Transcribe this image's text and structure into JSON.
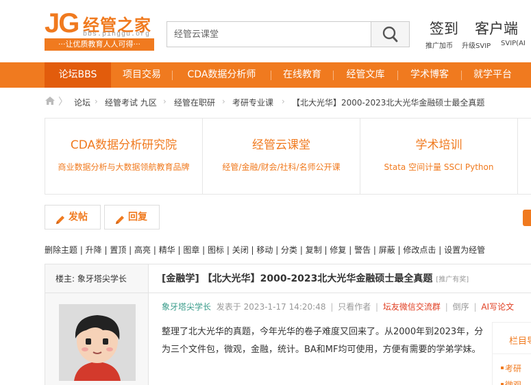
{
  "header": {
    "logo": {
      "mark": "JG",
      "name": "经管之家",
      "url": "bbs.pinggu.org",
      "slogan": "···让优质教育人人可得···"
    },
    "search": {
      "placeholder": "经管云课堂"
    },
    "links": {
      "signin": "签到",
      "client": "客户端"
    },
    "sublinks": [
      "推广加币",
      "升级SVIP",
      "SVIP(AI"
    ]
  },
  "nav": {
    "items": [
      "论坛BBS",
      "项目交易",
      "CDA数据分析师",
      "在线教育",
      "经管文库",
      "学术博客",
      "就学平台"
    ]
  },
  "breadcrumb": {
    "items": [
      "论坛",
      "经管考试 九区",
      "经管在职研",
      "考研专业课",
      "【北大光华】2000-2023北大光华金融硕士最全真题"
    ]
  },
  "promos": [
    {
      "title": "CDA数据分析研究院",
      "subtitle": "商业数据分析与大数据领航教育品牌"
    },
    {
      "title": "经管云课堂",
      "subtitle": "经管/金融/财会/社科/名师公开课"
    },
    {
      "title": "学术培训",
      "subtitle": "Stata 空间计量 SSCI Python"
    }
  ],
  "actions": {
    "post": "发帖",
    "reply": "回复"
  },
  "admin_tools": "删除主题 | 升降 | 置顶 | 高亮 | 精华 | 图章 | 图标 | 关闭 | 移动 | 分类 | 复制 | 修复 | 警告 | 屏蔽 | 修改点击 | 设置为经管",
  "post": {
    "floor_label": "楼主: 象牙塔尖学长",
    "title": "[金融学] 【北大光华】2000-2023北大光华金融硕士最全真题",
    "title_tag": "[推广有奖]",
    "author": "象牙塔尖学长",
    "posted": "发表于 2023-1-17 14:20:48",
    "only_author": "只看作者",
    "wechat": "坛友微信交流群",
    "reverse": "倒序",
    "ai": "AI写论文",
    "body": "整理了北大光华的真题，今年光华的卷子难度又回来了。从2000年到2023年，分为三个文件包，微观，金融，统计。BA和MF均可使用，方便有需要的学弟学妹。"
  },
  "sidebar": {
    "heading": "栏目导",
    "item1": "考研",
    "item2": "微观"
  }
}
